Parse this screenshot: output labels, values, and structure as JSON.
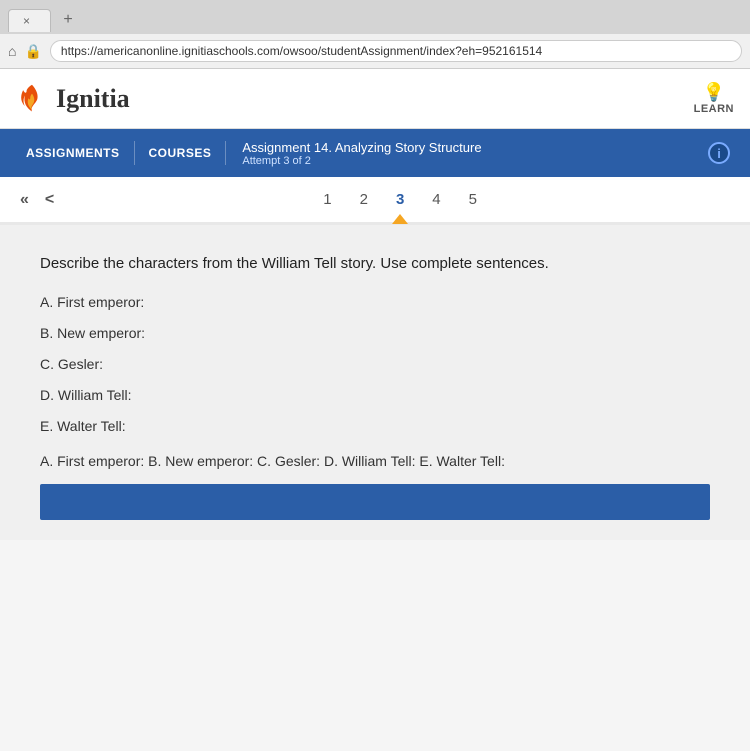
{
  "browser": {
    "tab_close": "×",
    "tab_plus": "+",
    "url": "https://americanonline.ignitiaschools.com/owsoo/studentAssignment/index?eh=952161514",
    "home_icon": "⌂",
    "lock_icon": "🔒"
  },
  "header": {
    "logo_text": "Ignitia",
    "learn_label": "LEARN"
  },
  "nav": {
    "assignments_label": "ASSIGNMENTS",
    "courses_label": "COURSES",
    "assignment_prefix": "Assignment",
    "assignment_name": "14. Analyzing Story Structure",
    "attempt_label": "Attempt 3 of 2",
    "info_symbol": "i"
  },
  "question_nav": {
    "double_left": "«",
    "single_left": "<",
    "numbers": [
      "1",
      "2",
      "3",
      "4",
      "5"
    ],
    "current": 3
  },
  "content": {
    "question": "Describe the characters from the William Tell story. Use complete sentences.",
    "answers": [
      "A. First emperor:",
      "B. New emperor:",
      "C. Gesler:",
      "D. William Tell:",
      "E. Walter Tell:"
    ],
    "combined": "A. First emperor: B. New emperor: C. Gesler: D. William Tell: E. Walter Tell:"
  }
}
